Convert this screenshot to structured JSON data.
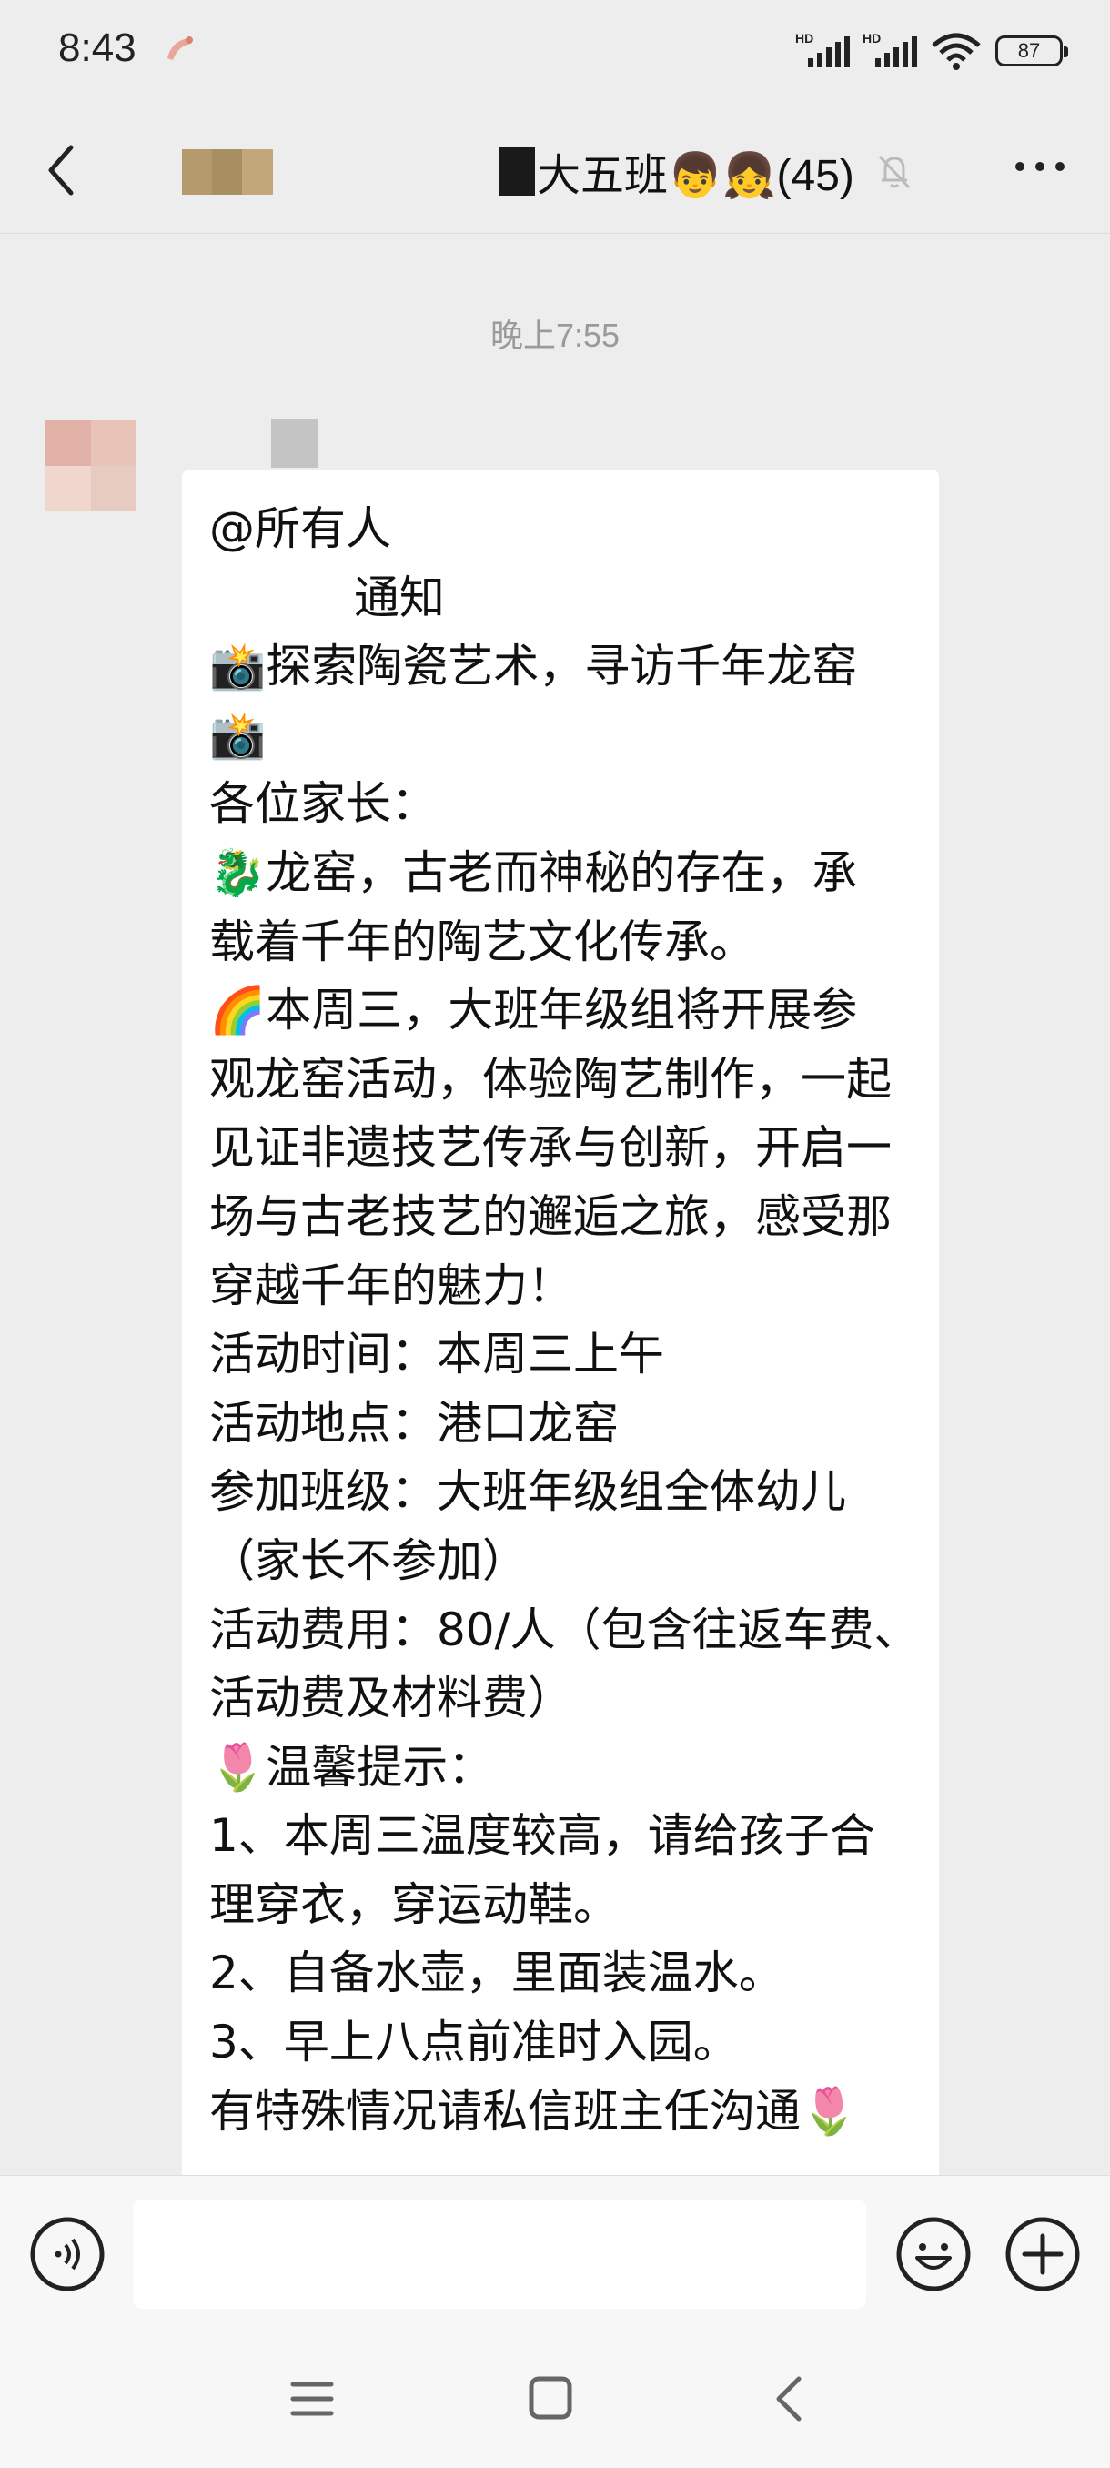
{
  "status_bar": {
    "time": "8:43",
    "signal1_label": "HD",
    "signal2_label": "HD",
    "battery": "87"
  },
  "header": {
    "title": "大五班👦👧(45)",
    "icons": [
      "back-arrow-icon",
      "mute-bell-icon",
      "more-icon"
    ]
  },
  "chat": {
    "timestamp": "晚上7:55",
    "message": "@所有人\n          通知\n📸探索陶瓷艺术，寻访千年龙窑\n📸\n各位家长：\n🐉龙窑，古老而神秘的存在，承\n载着千年的陶艺文化传承。\n🌈本周三，大班年级组将开展参\n观龙窑活动，体验陶艺制作，一起\n见证非遗技艺传承与创新，开启一\n场与古老技艺的邂逅之旅，感受那\n穿越千年的魅力！\n活动时间：本周三上午\n活动地点：港口龙窑\n参加班级：大班年级组全体幼儿\n（家长不参加）\n活动费用：80/人（包含往返车费、\n活动费及材料费）\n🌷温馨提示：\n1、本周三温度较高，请给孩子合\n理穿衣，穿运动鞋。\n2、自备水壶，里面装温水。\n3、早上八点前准时入园。\n有特殊情况请私信班主任沟通🌷"
  },
  "input_bar": {
    "text_value": "",
    "icons": [
      "voice-icon",
      "emoji-icon",
      "plus-icon"
    ]
  },
  "nav_bar": {
    "icons": [
      "menu-icon",
      "home-icon",
      "back-icon"
    ]
  },
  "colors": {
    "background": "#ededed",
    "bubble": "#ffffff",
    "timestamp": "#9a9a9a",
    "input_bar": "#f7f7f7"
  }
}
